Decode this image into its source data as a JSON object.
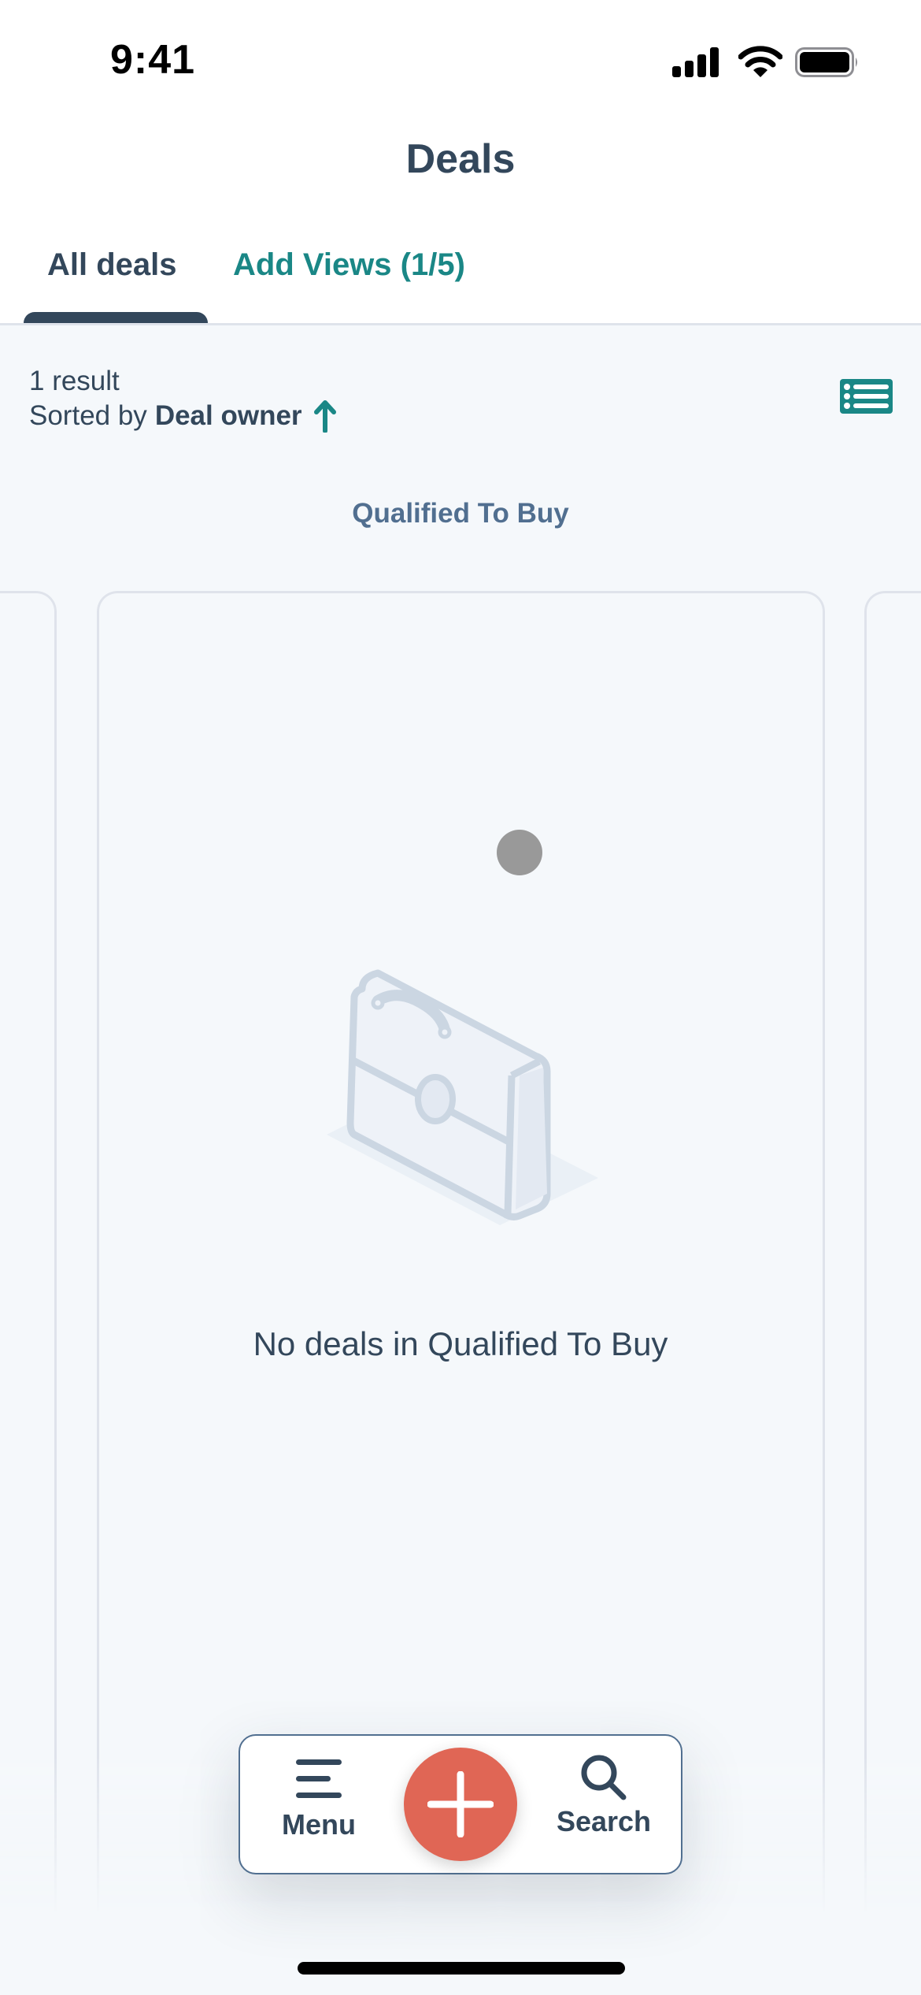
{
  "status_bar": {
    "time": "9:41",
    "icons": [
      "signal-icon",
      "wifi-icon",
      "battery-icon"
    ]
  },
  "header": {
    "title": "Deals"
  },
  "tabs": [
    {
      "label": "All deals",
      "active": true
    },
    {
      "label": "Add Views (1/5)",
      "active": false
    }
  ],
  "summary": {
    "result_count": "1 result",
    "sorted_prefix": "Sorted by",
    "sorted_field": "Deal owner",
    "sort_direction": "ascending",
    "sort_icon": "arrow-up-icon",
    "view_toggle_icon": "list-view-icon"
  },
  "board": {
    "stage_title": "Qualified To Buy",
    "empty_message": "No deals in Qualified To Buy",
    "empty_icon": "briefcase-icon"
  },
  "bottom_nav": {
    "menu_label": "Menu",
    "search_label": "Search",
    "add_icon": "plus-icon"
  },
  "colors": {
    "primary_text": "#33475b",
    "accent_teal": "#1a8786",
    "fab_coral": "#e06655",
    "background": "#f5f8fb"
  }
}
